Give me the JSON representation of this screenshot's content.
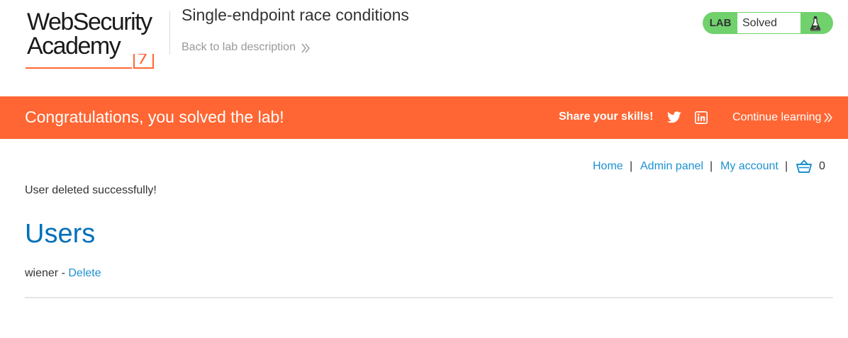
{
  "header": {
    "logo": {
      "line1": "WebSecurity",
      "line2": "Academy"
    },
    "lab_title": "Single-endpoint race conditions",
    "back_link": "Back to lab description",
    "lab_status": {
      "label": "LAB",
      "state": "Solved"
    }
  },
  "banner": {
    "message": "Congratulations, you solved the lab!",
    "share_label": "Share your skills!",
    "continue_label": "Continue learning",
    "icons": [
      "twitter-icon",
      "linkedin-icon"
    ]
  },
  "nav": {
    "home": "Home",
    "admin_panel": "Admin panel",
    "my_account": "My account",
    "separator": "|",
    "cart_count": "0"
  },
  "main": {
    "status_message": "User deleted successfully!",
    "heading": "Users",
    "users": [
      {
        "name": "wiener",
        "separator": " - ",
        "action": "Delete"
      }
    ]
  },
  "colors": {
    "banner": "#ff6633",
    "lab_badge": "#70d16d",
    "link": "#1d91d0",
    "heading": "#0070b9",
    "logo_accent": "#ff6633"
  }
}
